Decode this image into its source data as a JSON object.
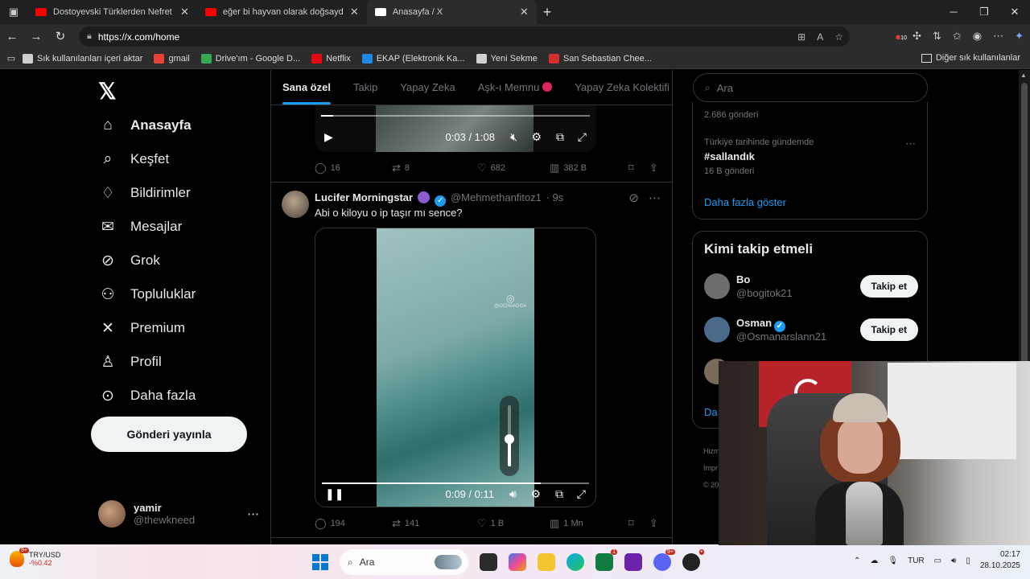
{
  "browser": {
    "tabs": [
      {
        "title": "Dostoyevski Türklerden Nefret Ed",
        "favicon_color": "#ff0000"
      },
      {
        "title": "eğer bi hayvan olarak doğsaydın",
        "favicon_color": "#ff0000"
      },
      {
        "title": "Anasayfa / X",
        "favicon_color": "#ffffff"
      }
    ],
    "url": "https://x.com/home",
    "extension_badge": "10",
    "bookmarks": [
      {
        "label": "Sık kullanılanları içeri aktar",
        "color": "#cfcfcf"
      },
      {
        "label": "gmail",
        "color": "#ea4335"
      },
      {
        "label": "Drive'ım - Google D...",
        "color": "#34a853"
      },
      {
        "label": "Netflix",
        "color": "#e50914"
      },
      {
        "label": "EKAP (Elektronik Ka...",
        "color": "#1e88e5"
      },
      {
        "label": "Yeni Sekme",
        "color": "#cfcfcf"
      },
      {
        "label": "San Sebastian Chee...",
        "color": "#d32f2f"
      }
    ],
    "other_favorites": "Diğer sık kullanılanlar"
  },
  "sidebar": {
    "items": [
      {
        "label": "Anasayfa",
        "icon": "home-icon",
        "glyph": "⌂",
        "bold": true
      },
      {
        "label": "Keşfet",
        "icon": "search-icon",
        "glyph": "⌕",
        "bold": false
      },
      {
        "label": "Bildirimler",
        "icon": "bell-icon",
        "glyph": "♢",
        "bold": false
      },
      {
        "label": "Mesajlar",
        "icon": "mail-icon",
        "glyph": "✉",
        "bold": false
      },
      {
        "label": "Grok",
        "icon": "grok-icon",
        "glyph": "⊘",
        "bold": false
      },
      {
        "label": "Topluluklar",
        "icon": "communities-icon",
        "glyph": "⚇",
        "bold": false
      },
      {
        "label": "Premium",
        "icon": "premium-icon",
        "glyph": "✕",
        "bold": false
      },
      {
        "label": "Profil",
        "icon": "profile-icon",
        "glyph": "♙",
        "bold": false
      },
      {
        "label": "Daha fazla",
        "icon": "more-circle-icon",
        "glyph": "⊙",
        "bold": false
      }
    ],
    "post_button": "Gönderi yayınla",
    "user": {
      "name": "yamir",
      "handle": "@thewkneed"
    }
  },
  "feed": {
    "tabs": [
      "Sana özel",
      "Takip",
      "Yapay Zeka",
      "Aşk-ı Memnu",
      "Yapay Zeka Kolektifi"
    ],
    "selected_tab": 0,
    "post1": {
      "video_time": "0:03 / 1:08",
      "progress": 0.045,
      "replies": "16",
      "reposts": "8",
      "likes": "682",
      "views": "382 B"
    },
    "post2": {
      "name": "Lucifer Morningstar",
      "handle": "@Mehmethanfitoz1",
      "time": "· 9s",
      "text": "Abi o kiloyu o ip taşır mı sence?",
      "watermark": "@OCHAADOA",
      "video_time": "0:09 / 0:11",
      "progress": 0.82,
      "volume": 0.45,
      "replies": "194",
      "reposts": "141",
      "likes": "1 B",
      "views": "1 Mn"
    }
  },
  "right": {
    "search_placeholder": "Ara",
    "trends": {
      "prev_count": "2.686 gönderi",
      "context": "Türkiye tarihinde gündemde",
      "tag": "#sallandık",
      "count": "16 B gönderi",
      "show_more": "Daha fazla göster"
    },
    "who_to_follow": {
      "title": "Kimi takip etmeli",
      "users": [
        {
          "name": "Bo",
          "handle": "@bogitok21",
          "verified": false,
          "color": "#6d6d6d"
        },
        {
          "name": "Osman",
          "handle": "@Osmanarslann21",
          "verified": true,
          "color": "#4a6a8a"
        }
      ],
      "follow_label": "Takip et",
      "more_partial": "Da"
    },
    "footer": [
      "Hizm",
      "Impr",
      "© 20"
    ]
  },
  "taskbar": {
    "ticker_name": "TRY/USD",
    "ticker_change": "-%0.42",
    "ticker_badge": "9+",
    "search_label": "Ara",
    "lang": "TUR",
    "time": "02:17",
    "date": "28.10.2025"
  }
}
